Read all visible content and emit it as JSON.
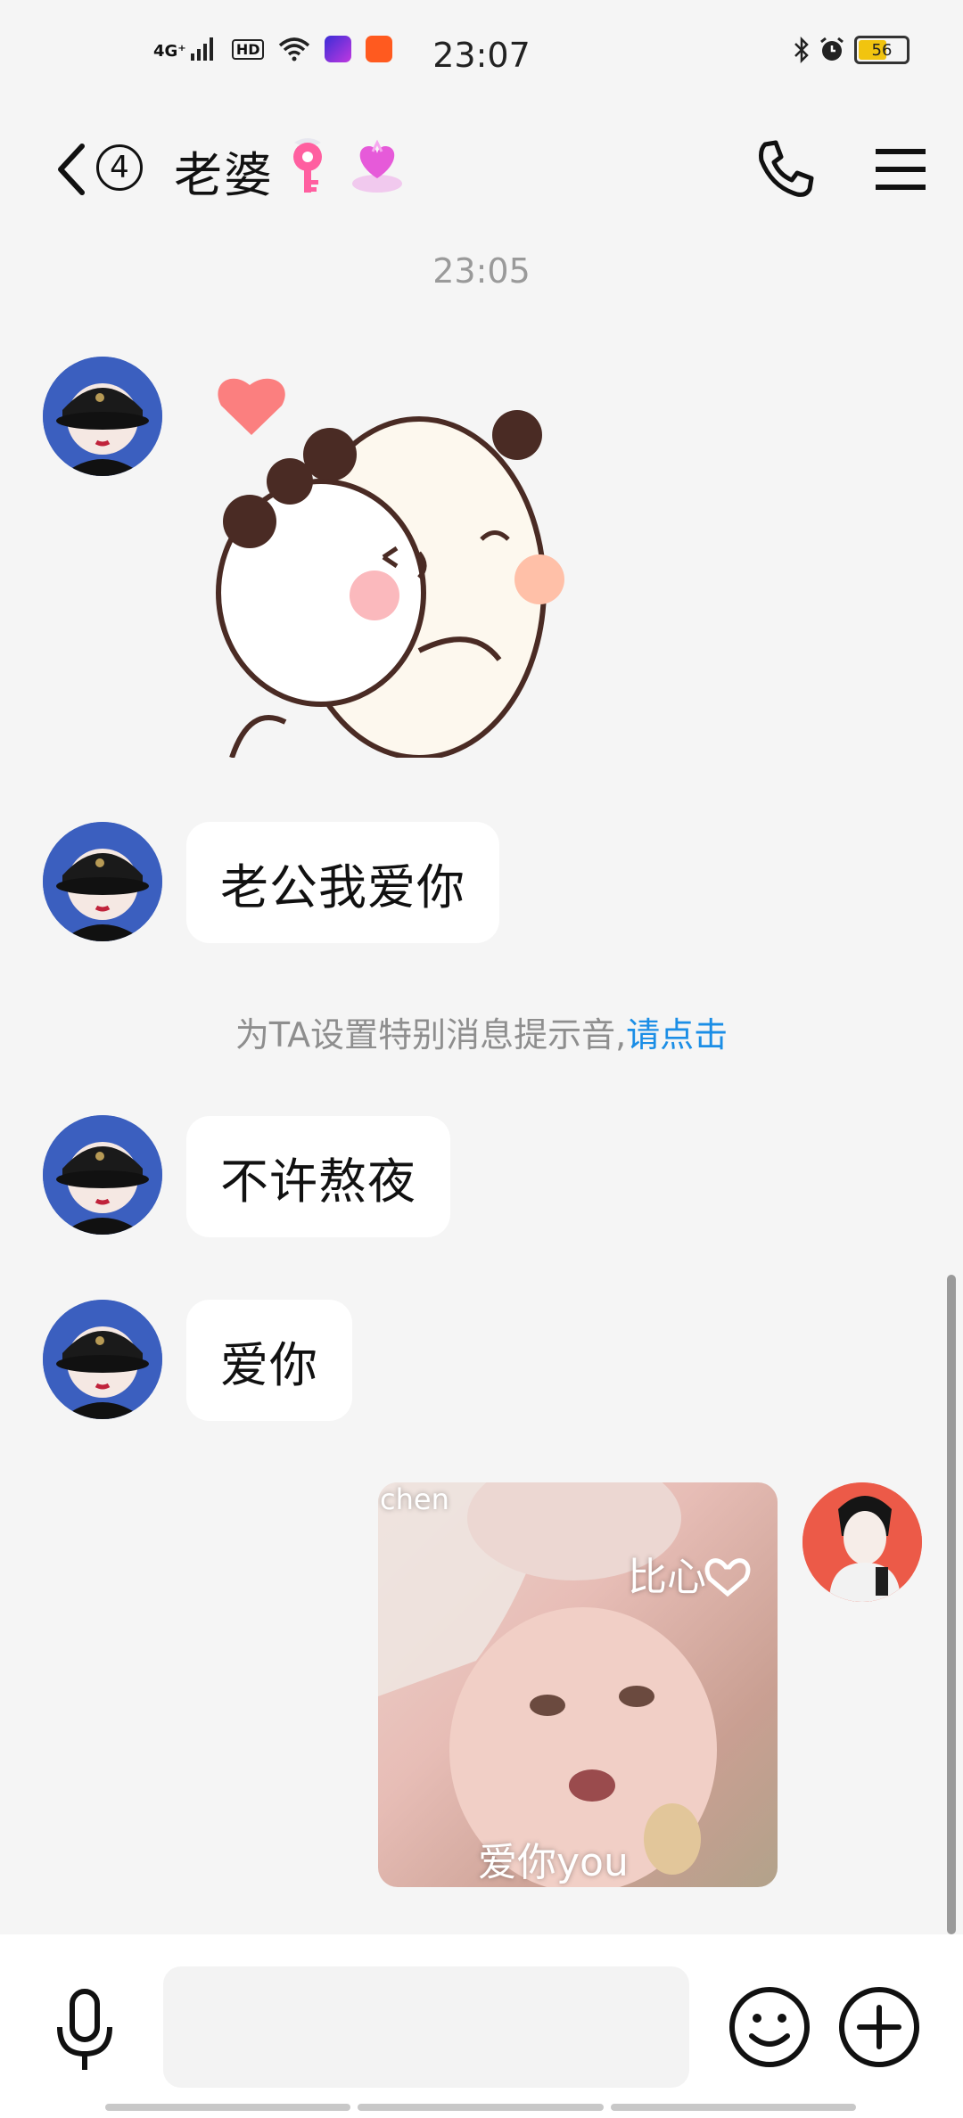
{
  "status_bar": {
    "network": "4G⁺",
    "hd_badge": "HD",
    "time": "23:07",
    "battery_level": "56",
    "battery_fraction": 0.56
  },
  "header": {
    "unread_count": "4",
    "contact_name": "老婆",
    "icons": [
      "back-chevron-icon",
      "key-heart-emoji",
      "heart-gem-emoji",
      "phone-icon",
      "menu-icon"
    ]
  },
  "chat": {
    "timestamp": "23:05",
    "messages": [
      {
        "side": "left",
        "type": "sticker",
        "sticker": "hugging-bears"
      },
      {
        "side": "left",
        "type": "text",
        "text": "老公我爱你"
      },
      {
        "side": "left",
        "type": "text",
        "text": "不许熬夜"
      },
      {
        "side": "left",
        "type": "text",
        "text": "爱你"
      },
      {
        "side": "right",
        "type": "image",
        "overlay_texts": [
          "chen",
          "比心",
          "爱你you"
        ]
      }
    ],
    "system_note": {
      "text": "为TA设置特别消息提示音,",
      "link": "请点击"
    }
  },
  "input_bar": {
    "placeholder": "",
    "value": ""
  },
  "colors": {
    "background": "#f5f5f5",
    "bubble": "#ffffff",
    "link": "#1b8ee6",
    "timestamp": "#9a9a9a"
  }
}
